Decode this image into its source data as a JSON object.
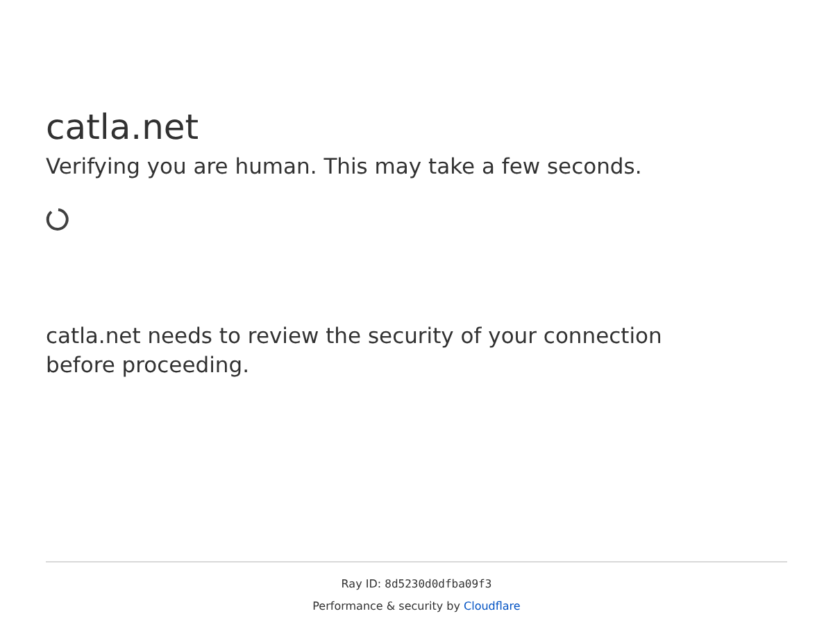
{
  "site": {
    "title": "catla.net",
    "subtitle": "Verifying you are human. This may take a few seconds."
  },
  "message": "catla.net needs to review the security of your connection before proceeding.",
  "footer": {
    "ray_label": "Ray ID:",
    "ray_id": "8d5230d0dfba09f3",
    "credit": "Performance & security by",
    "link": "Cloudflare"
  }
}
